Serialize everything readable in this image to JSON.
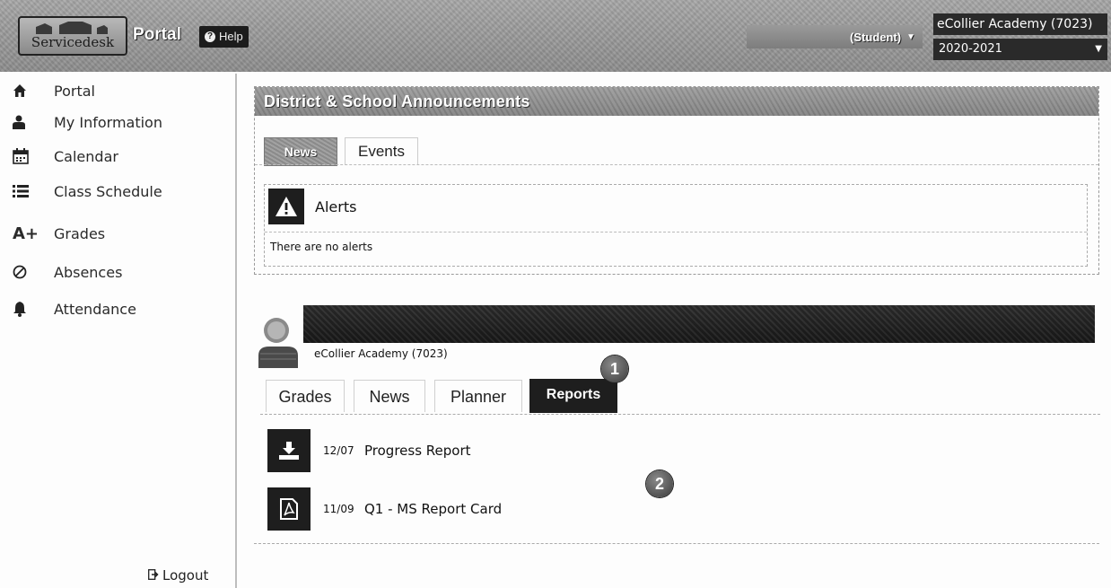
{
  "header": {
    "logo_text": "Servicedesk",
    "portal_title": "Portal",
    "help_label": "Help",
    "user_role": "(Student)",
    "school_name": "eCollier Academy (7023)",
    "school_year": "2020-2021"
  },
  "sidebar": {
    "items": [
      {
        "label": "Portal",
        "icon": "home-icon"
      },
      {
        "label": "My Information",
        "icon": "user-icon"
      },
      {
        "label": "Calendar",
        "icon": "calendar-icon"
      },
      {
        "label": "Class Schedule",
        "icon": "list-icon"
      },
      {
        "label": "Grades",
        "icon": "grades-icon"
      },
      {
        "label": "Absences",
        "icon": "absences-icon"
      },
      {
        "label": "Attendance",
        "icon": "bell-icon"
      }
    ],
    "logout_label": "Logout",
    "grades_icon_text": "A+"
  },
  "announcements": {
    "title": "District & School Announcements",
    "tabs": [
      "News",
      "Events"
    ],
    "alerts_title": "Alerts",
    "alerts_message": "There are no alerts"
  },
  "student": {
    "school": "eCollier Academy (7023)",
    "tabs": [
      "Grades",
      "News",
      "Planner",
      "Reports"
    ],
    "active_tab": "Reports",
    "reports": [
      {
        "date": "12/07",
        "title": "Progress Report",
        "icon": "download-icon"
      },
      {
        "date": "11/09",
        "title": "Q1 - MS Report Card",
        "icon": "pdf-icon"
      }
    ]
  },
  "callouts": [
    "1",
    "2"
  ],
  "colors": {
    "header_bg": "#8f8f8f",
    "dark": "#1e1e1e",
    "text": "#222222"
  }
}
